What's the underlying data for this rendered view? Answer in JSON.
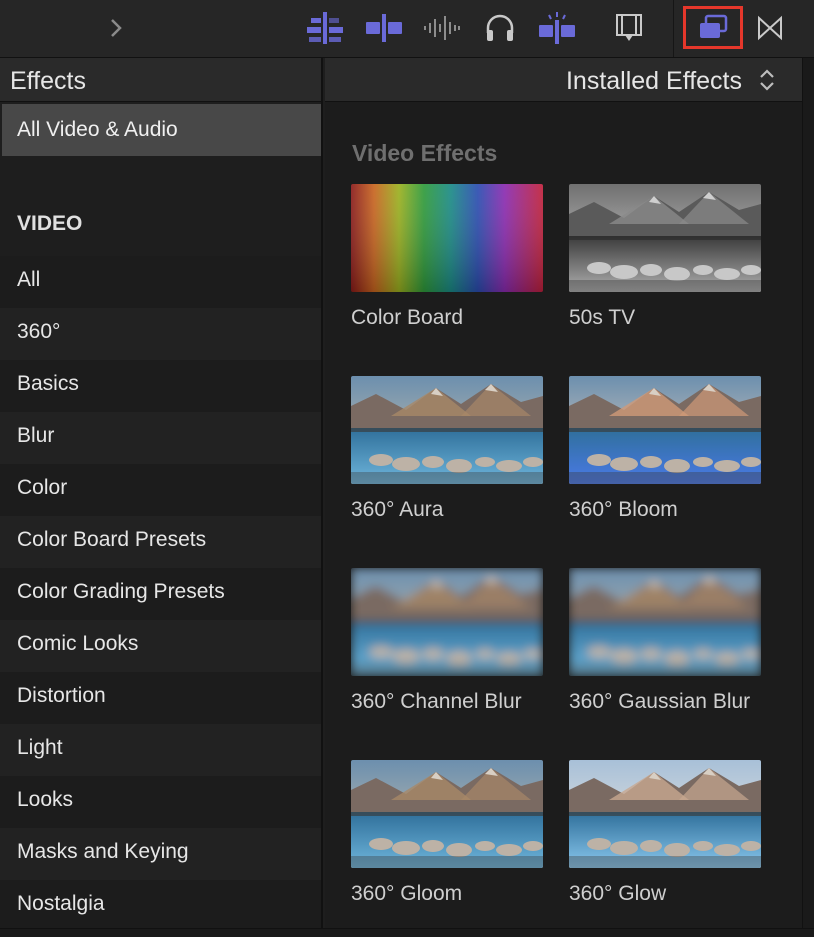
{
  "toolbar": {
    "buttons": [
      {
        "icon": "chevron-right-icon"
      },
      {
        "icon": "clip-appearance-icon"
      },
      {
        "icon": "clip-split-icon"
      },
      {
        "icon": "audio-waveform-icon"
      },
      {
        "icon": "headphones-icon"
      },
      {
        "icon": "skimming-icon"
      },
      {
        "icon": "filmstrip-icon"
      },
      {
        "icon": "effects-browser-icon"
      },
      {
        "icon": "transitions-browser-icon"
      }
    ],
    "accent_color": "#6a6ad8",
    "highlight_color": "#e5372b"
  },
  "sidebar": {
    "title": "Effects",
    "selected": "All Video & Audio",
    "section": "VIDEO",
    "items": [
      "All",
      "360°",
      "Basics",
      "Blur",
      "Color",
      "Color Board Presets",
      "Color Grading Presets",
      "Comic Looks",
      "Distortion",
      "Light",
      "Looks",
      "Masks and Keying",
      "Nostalgia"
    ]
  },
  "main": {
    "dropdown": "Installed Effects",
    "section_title": "Video Effects",
    "effects": [
      {
        "name": "Color Board",
        "style": "rainbow"
      },
      {
        "name": "50s TV",
        "style": "mono"
      },
      {
        "name": "360° Aura",
        "style": "normal"
      },
      {
        "name": "360° Bloom",
        "style": "bloom"
      },
      {
        "name": "360° Channel Blur",
        "style": "blur"
      },
      {
        "name": "360° Gaussian Blur",
        "style": "blur"
      },
      {
        "name": "360° Gloom",
        "style": "normal"
      },
      {
        "name": "360° Glow",
        "style": "glow"
      }
    ]
  }
}
